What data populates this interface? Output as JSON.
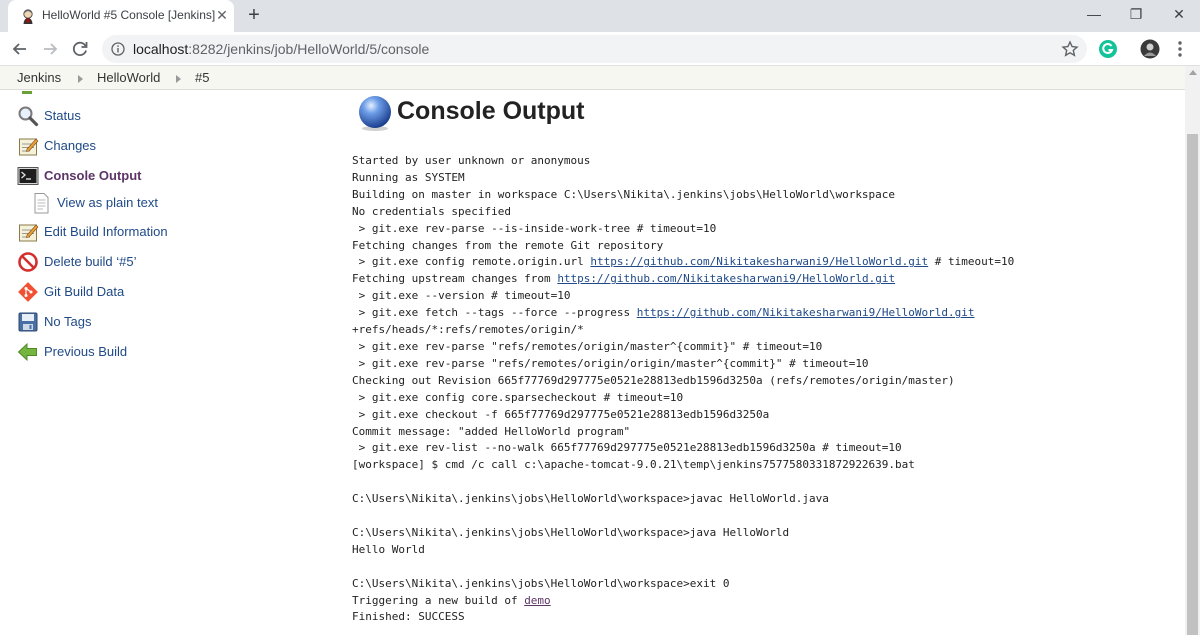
{
  "browser": {
    "tab_title": "HelloWorld #5 Console [Jenkins]",
    "tab_close": "✕",
    "new_tab": "+",
    "url_host": "localhost",
    "url_path": ":8282/jenkins/job/HelloWorld/5/console",
    "window_controls": {
      "minimize": "—",
      "restore": "❐",
      "close": "✕"
    }
  },
  "breadcrumb": [
    "Jenkins",
    "HelloWorld",
    "#5"
  ],
  "sidepanel": {
    "items": [
      {
        "label": "Status",
        "icon": "magnifier-icon"
      },
      {
        "label": "Changes",
        "icon": "notepad-icon"
      },
      {
        "label": "Console Output",
        "icon": "terminal-icon",
        "active": true
      },
      {
        "label": "View as plain text",
        "icon": "document-icon"
      },
      {
        "label": "Edit Build Information",
        "icon": "notepad-icon"
      },
      {
        "label": "Delete build ‘#5’",
        "icon": "no-entry-icon"
      },
      {
        "label": "Git Build Data",
        "icon": "git-icon"
      },
      {
        "label": "No Tags",
        "icon": "save-icon"
      },
      {
        "label": "Previous Build",
        "icon": "arrow-left-icon"
      }
    ]
  },
  "main": {
    "title": "Console Output",
    "console_lines": [
      [
        {
          "t": "Started by user unknown or anonymous"
        }
      ],
      [
        {
          "t": "Running as SYSTEM"
        }
      ],
      [
        {
          "t": "Building on master in workspace C:\\Users\\Nikita\\.jenkins\\jobs\\HelloWorld\\workspace"
        }
      ],
      [
        {
          "t": "No credentials specified"
        }
      ],
      [
        {
          "t": " > git.exe rev-parse --is-inside-work-tree # timeout=10"
        }
      ],
      [
        {
          "t": "Fetching changes from the remote Git repository"
        }
      ],
      [
        {
          "t": " > git.exe config remote.origin.url "
        },
        {
          "t": "https://github.com/Nikitakesharwani9/HelloWorld.git",
          "link": true
        },
        {
          "t": " # timeout=10"
        }
      ],
      [
        {
          "t": "Fetching upstream changes from "
        },
        {
          "t": "https://github.com/Nikitakesharwani9/HelloWorld.git",
          "link": true
        }
      ],
      [
        {
          "t": " > git.exe --version # timeout=10"
        }
      ],
      [
        {
          "t": " > git.exe fetch --tags --force --progress "
        },
        {
          "t": "https://github.com/Nikitakesharwani9/HelloWorld.git",
          "link": true
        }
      ],
      [
        {
          "t": "+refs/heads/*:refs/remotes/origin/*"
        }
      ],
      [
        {
          "t": " > git.exe rev-parse \"refs/remotes/origin/master^{commit}\" # timeout=10"
        }
      ],
      [
        {
          "t": " > git.exe rev-parse \"refs/remotes/origin/origin/master^{commit}\" # timeout=10"
        }
      ],
      [
        {
          "t": "Checking out Revision 665f77769d297775e0521e28813edb1596d3250a (refs/remotes/origin/master)"
        }
      ],
      [
        {
          "t": " > git.exe config core.sparsecheckout # timeout=10"
        }
      ],
      [
        {
          "t": " > git.exe checkout -f 665f77769d297775e0521e28813edb1596d3250a"
        }
      ],
      [
        {
          "t": "Commit message: \"added HelloWorld program\""
        }
      ],
      [
        {
          "t": " > git.exe rev-list --no-walk 665f77769d297775e0521e28813edb1596d3250a # timeout=10"
        }
      ],
      [
        {
          "t": "[workspace] $ cmd /c call c:\\apache-tomcat-9.0.21\\temp\\jenkins7577580331872922639.bat"
        }
      ],
      [
        {
          "t": ""
        }
      ],
      [
        {
          "t": "C:\\Users\\Nikita\\.jenkins\\jobs\\HelloWorld\\workspace>javac HelloWorld.java"
        }
      ],
      [
        {
          "t": ""
        }
      ],
      [
        {
          "t": "C:\\Users\\Nikita\\.jenkins\\jobs\\HelloWorld\\workspace>java HelloWorld"
        }
      ],
      [
        {
          "t": "Hello World"
        }
      ],
      [
        {
          "t": ""
        }
      ],
      [
        {
          "t": "C:\\Users\\Nikita\\.jenkins\\jobs\\HelloWorld\\workspace>exit 0"
        }
      ],
      [
        {
          "t": "Triggering a new build of "
        },
        {
          "t": "demo",
          "link": true,
          "visited": true
        }
      ],
      [
        {
          "t": "Finished: SUCCESS"
        }
      ]
    ]
  }
}
